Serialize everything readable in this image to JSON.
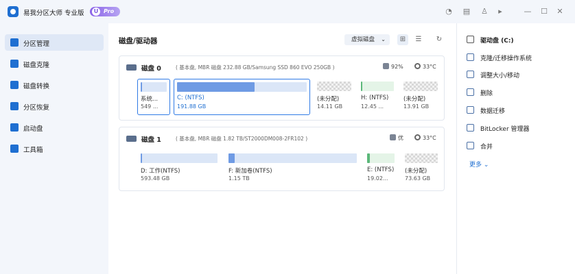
{
  "app": {
    "title": "易我分区大师 专业版",
    "badge": "Pro",
    "badge_letter": "U"
  },
  "titlebar_icons": [
    "headset-icon",
    "document-icon",
    "shirt-icon",
    "play-icon",
    "minimize-icon",
    "maximize-icon",
    "close-icon"
  ],
  "sidebar": {
    "items": [
      {
        "label": "分区管理",
        "icon": "partition-icon",
        "active": true
      },
      {
        "label": "磁盘克隆",
        "icon": "disk-clone-icon",
        "active": false
      },
      {
        "label": "磁盘转换",
        "icon": "disk-convert-icon",
        "active": false
      },
      {
        "label": "分区恢复",
        "icon": "partition-recovery-icon",
        "active": false
      },
      {
        "label": "启动盘",
        "icon": "boot-disk-icon",
        "active": false
      },
      {
        "label": "工具箱",
        "icon": "toolbox-icon",
        "active": false
      }
    ]
  },
  "main": {
    "title": "磁盘/驱动器",
    "view_select": "虚拟磁盘",
    "icons": [
      "grid-view-icon",
      "list-view-icon",
      "refresh-icon"
    ],
    "disks": [
      {
        "name": "磁盘 0",
        "info": "( 基本盘, MBR 磁盘 232.88 GB/Samsung SSD 860 EVO 250GB )",
        "health": "92%",
        "temp": "33°C",
        "partitions": [
          {
            "name": "系统...",
            "size": "549 ...",
            "used_fraction": 0.05,
            "type": "normal",
            "selected": true
          },
          {
            "name": "C: (NTFS)",
            "size": "191.88 GB",
            "used_fraction": 0.6,
            "type": "normal",
            "selected": true
          },
          {
            "name": "(未分配)",
            "size": "14.11 GB",
            "used_fraction": 0,
            "type": "unalloc",
            "selected": false
          },
          {
            "name": "H: (NTFS)",
            "size": "12.45 ...",
            "used_fraction": 0.05,
            "type": "green",
            "selected": false
          },
          {
            "name": "(未分配)",
            "size": "13.91 GB",
            "used_fraction": 0,
            "type": "unalloc",
            "selected": false
          }
        ]
      },
      {
        "name": "磁盘 1",
        "info": "( 基本盘, MBR 磁盘 1.82 TB/ST2000DM008-2FR102 )",
        "health": "优",
        "temp": "33°C",
        "partitions": [
          {
            "name": "D: 工作(NTFS)",
            "size": "593.48 GB",
            "used_fraction": 0.02,
            "type": "normal",
            "selected": false
          },
          {
            "name": "F: 新加卷(NTFS)",
            "size": "1.15 TB",
            "used_fraction": 0.05,
            "type": "normal",
            "selected": false
          },
          {
            "name": "E: (NTFS)",
            "size": "19.02...",
            "used_fraction": 0.1,
            "type": "green",
            "selected": false
          },
          {
            "name": "(未分配)",
            "size": "73.63 GB",
            "used_fraction": 0,
            "type": "unalloc",
            "selected": false
          }
        ]
      }
    ]
  },
  "right_panel": {
    "drive": "驱动盘 (C:)",
    "ops": [
      {
        "label": "克隆/迁移操作系统",
        "icon": "clone-os-icon"
      },
      {
        "label": "调整大小/移动",
        "icon": "resize-move-icon"
      },
      {
        "label": "删除",
        "icon": "delete-icon"
      },
      {
        "label": "数据迁移",
        "icon": "data-migration-icon"
      },
      {
        "label": "BitLocker 管理器",
        "icon": "bitlocker-icon"
      },
      {
        "label": "合并",
        "icon": "merge-icon"
      }
    ],
    "more": "更多 ⌄"
  },
  "colors": {
    "accent": "#1f6fd1",
    "partition_used": "#6f9be4",
    "partition_free": "#dbe6f7",
    "healthy_green": "#5cb87a"
  }
}
